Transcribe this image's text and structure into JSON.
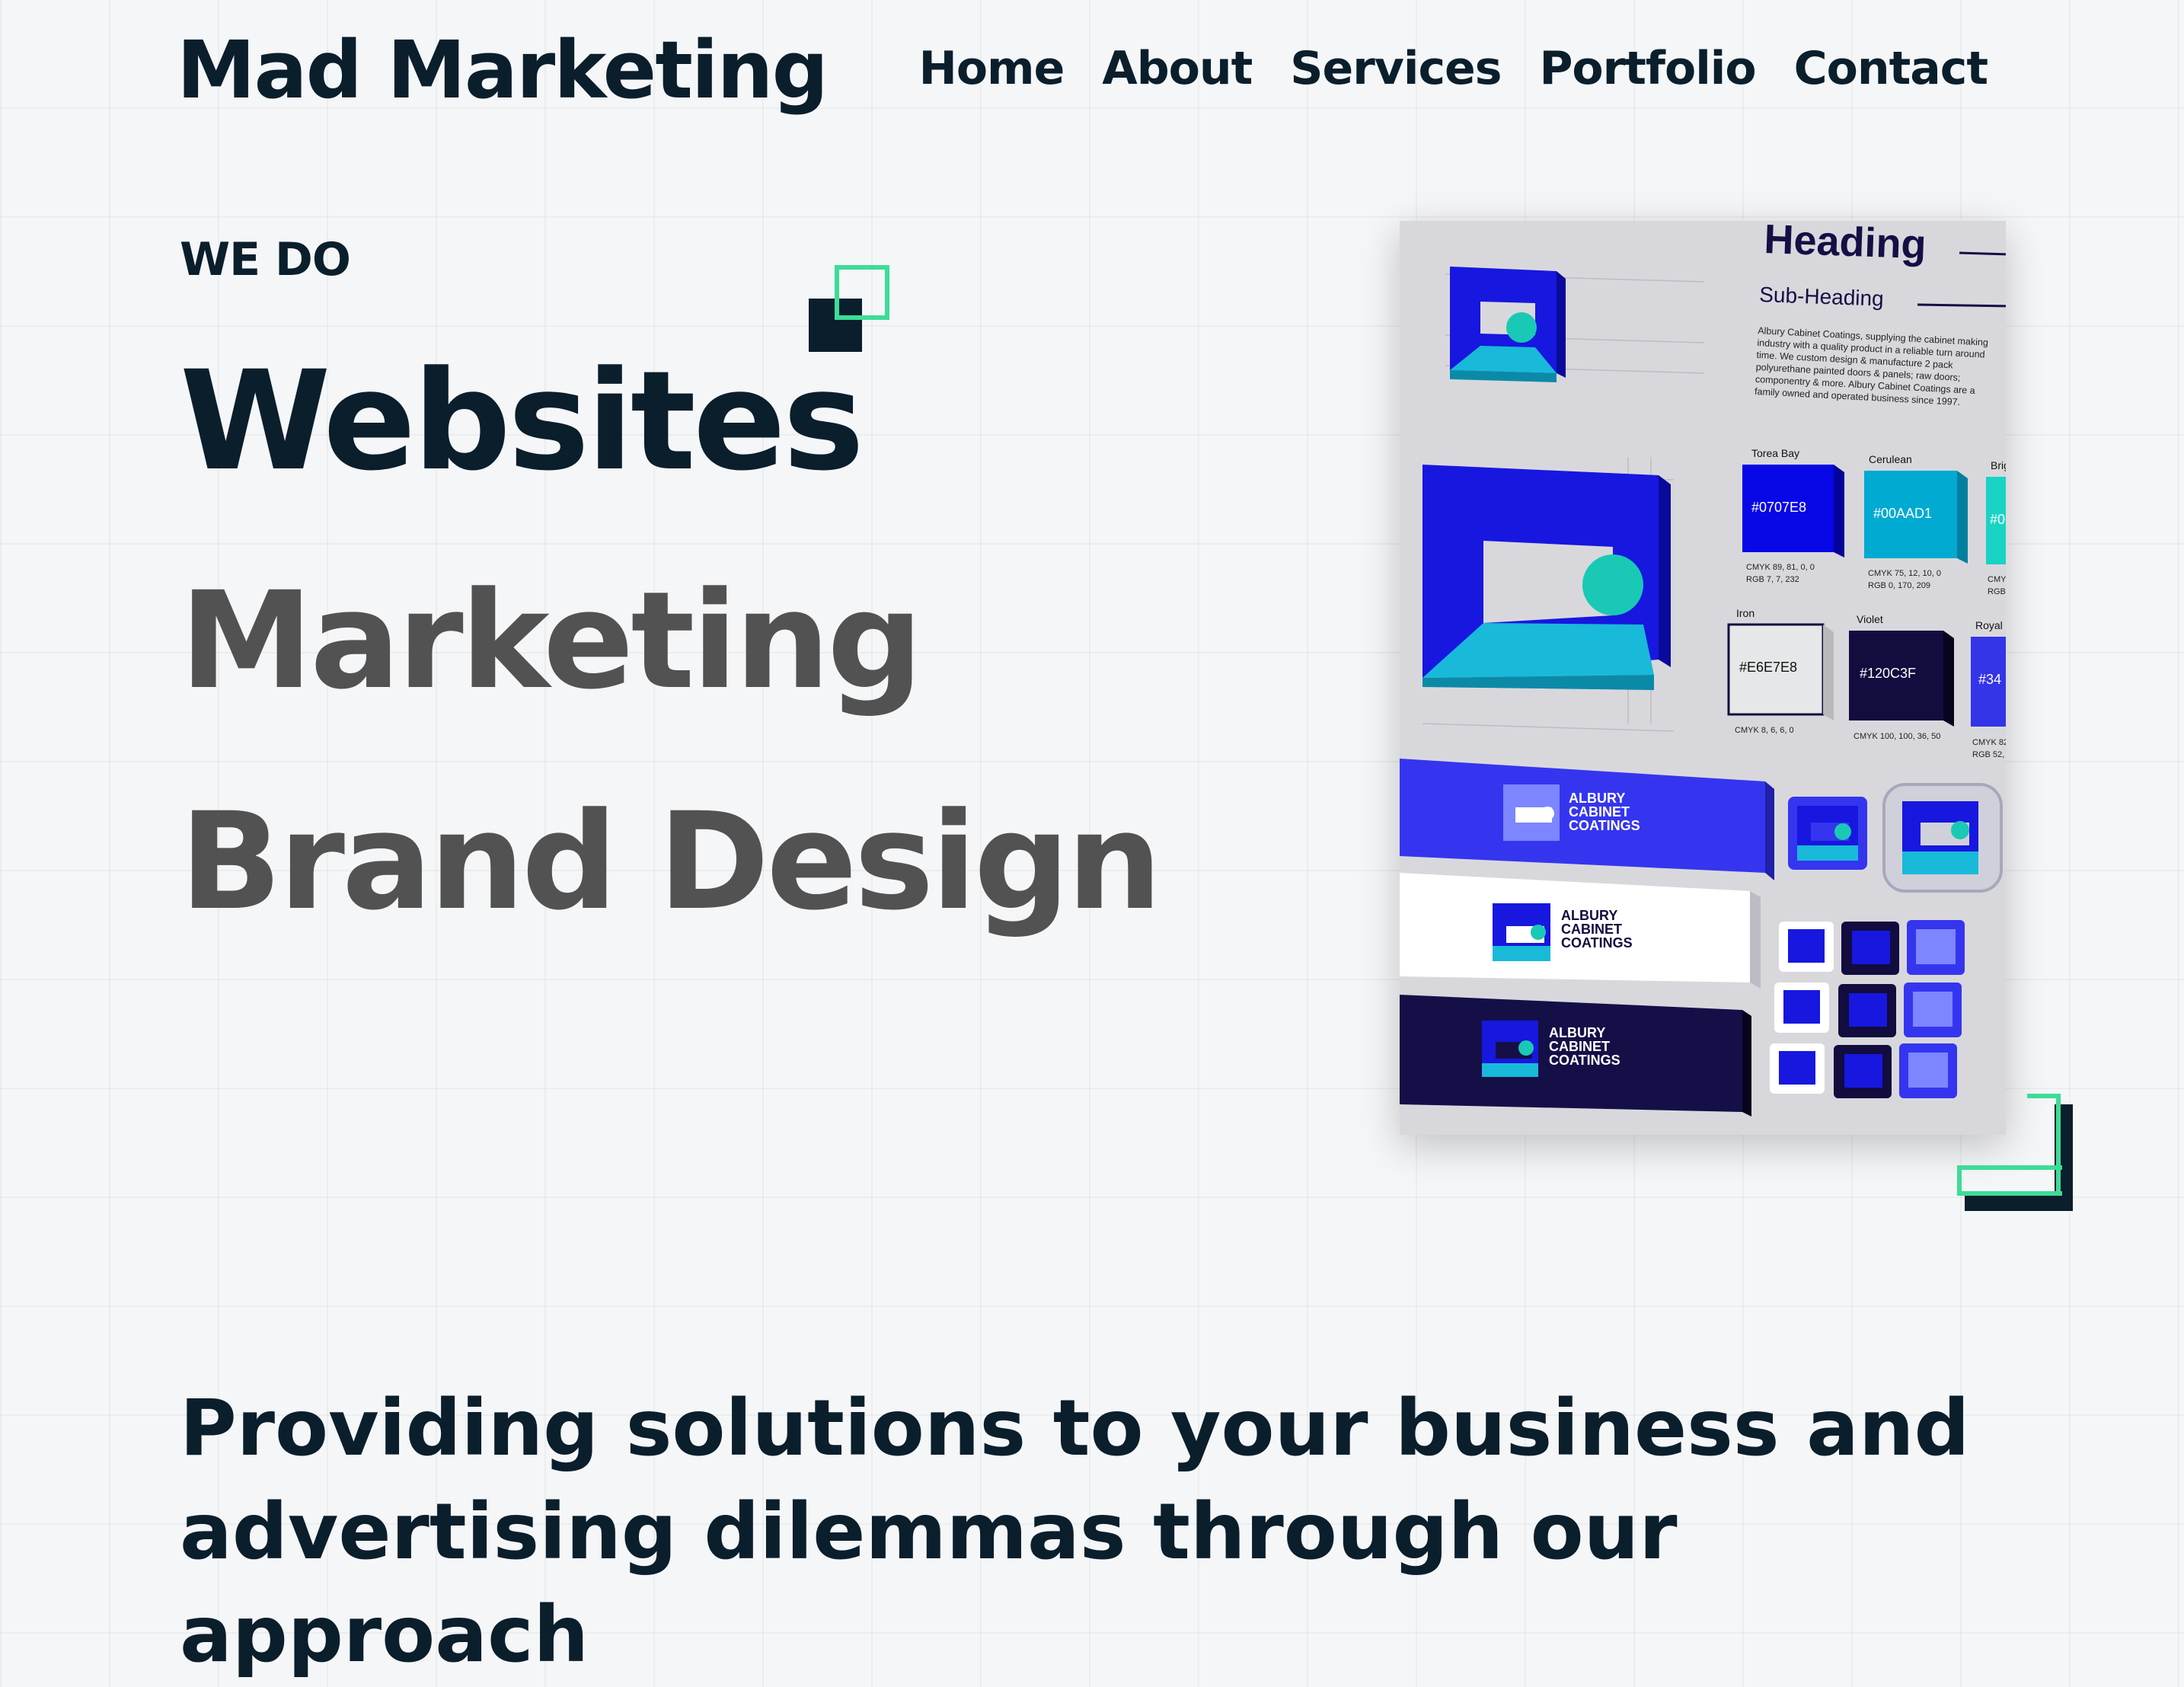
{
  "brand": {
    "name": "Mad Marketing"
  },
  "nav": {
    "items": [
      "Home",
      "About",
      "Services",
      "Portfolio",
      "Contact"
    ]
  },
  "hero": {
    "eyebrow": "WE DO",
    "services": [
      "Websites",
      "Marketing",
      "Brand Design"
    ]
  },
  "mockup": {
    "heading": "Heading",
    "subheading": "Sub-Heading",
    "paragraph": [
      "Albury Cabinet Coatings, supplying the cabinet making",
      "industry with a quality product in a reliable turn around",
      "time. We custom design & manufacture 2 pack",
      "polyurethane painted doors & panels; raw doors;",
      "componentry & more. Albury Cabinet Coatings are a",
      "family owned and operated business since 1997."
    ],
    "swatches": [
      {
        "name": "Torea Bay",
        "hex": "#0707E8",
        "cmyk": "CMYK 89, 81, 0, 0",
        "rgb": "RGB 7, 7, 232",
        "color": "#0707e8",
        "text_color": "#ffffff"
      },
      {
        "name": "Cerulean",
        "hex": "#00AAD1",
        "cmyk": "CMYK 75, 12, 10, 0",
        "rgb": "RGB 0, 170, 209",
        "color": "#00aad1",
        "text_color": "#ffffff"
      },
      {
        "name": "Brig",
        "hex": "#0",
        "cmyk": "CMY",
        "rgb": "RGB 0",
        "color": "#19d3c5",
        "text_color": "#ffffff"
      },
      {
        "name": "Iron",
        "hex": "#E6E7E8",
        "cmyk": "CMYK 8, 6, 6, 0",
        "rgb": "",
        "color": "#e6e7e8",
        "text_color": "#111111"
      },
      {
        "name": "Violet",
        "hex": "#120C3F",
        "cmyk": "CMYK 100, 100, 36, 50",
        "rgb": "",
        "color": "#120c3f",
        "text_color": "#ffffff"
      },
      {
        "name": "Royal",
        "hex": "#34",
        "cmyk": "CMYK 82",
        "rgb": "RGB 52, 1",
        "color": "#3434e8",
        "text_color": "#ffffff"
      }
    ],
    "logo_text": [
      "ALBURY",
      "CABINET",
      "COATINGS"
    ]
  },
  "tagline": {
    "lines": [
      "Providing solutions to your business and",
      "advertising dilemmas through our approach"
    ]
  }
}
